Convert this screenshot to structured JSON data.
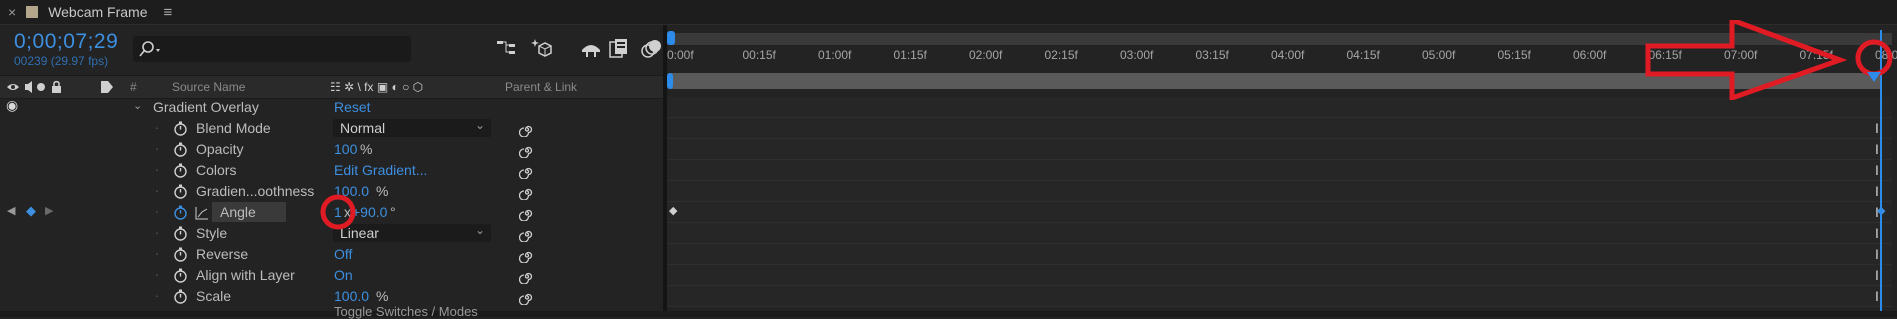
{
  "tab": {
    "close_icon": "close-icon",
    "title": "Webcam Frame",
    "menu_icon": "hamburger-menu-icon"
  },
  "time": {
    "timecode": "0;00;07;29",
    "frames": "00239 (29.97 fps)"
  },
  "search": {
    "placeholder": "",
    "icon": "search-icon"
  },
  "columns": {
    "index": "#",
    "source_name": "Source Name",
    "switches": "☷ ✲ \\ fx ▣ ◐ ○ ⬡",
    "parent": "Parent & Link"
  },
  "layer": {
    "effect_name": "Gradient Overlay",
    "reset_label": "Reset",
    "properties": [
      {
        "label": "Blend Mode",
        "kind": "dropdown",
        "value": "Normal"
      },
      {
        "label": "Opacity",
        "kind": "value",
        "value": "100",
        "unit": "%"
      },
      {
        "label": "Colors",
        "kind": "value",
        "value": "Edit Gradient..."
      },
      {
        "label": "Gradien...oothness",
        "kind": "value",
        "value": "100.0",
        "unit": "%"
      },
      {
        "label": "Angle",
        "kind": "angle",
        "value": "1",
        "value2": "x",
        "value3": "+90.0",
        "unit": "°"
      },
      {
        "label": "Style",
        "kind": "dropdown",
        "value": "Linear"
      },
      {
        "label": "Reverse",
        "kind": "value",
        "value": "Off"
      },
      {
        "label": "Align with Layer",
        "kind": "value",
        "value": "On"
      },
      {
        "label": "Scale",
        "kind": "value",
        "value": "100.0",
        "unit": "%"
      }
    ]
  },
  "ruler_ticks": [
    "0:00f",
    "00:15f",
    "01:00f",
    "01:15f",
    "02:00f",
    "02:15f",
    "03:00f",
    "03:15f",
    "04:00f",
    "04:15f",
    "05:00f",
    "05:15f",
    "06:00f",
    "06:15f",
    "07:00f",
    "07:15f",
    "08:0"
  ],
  "bottom_label": "Toggle Switches / Modes",
  "colors": {
    "accent": "#3d8fe0",
    "annotation": "#e01b24"
  }
}
